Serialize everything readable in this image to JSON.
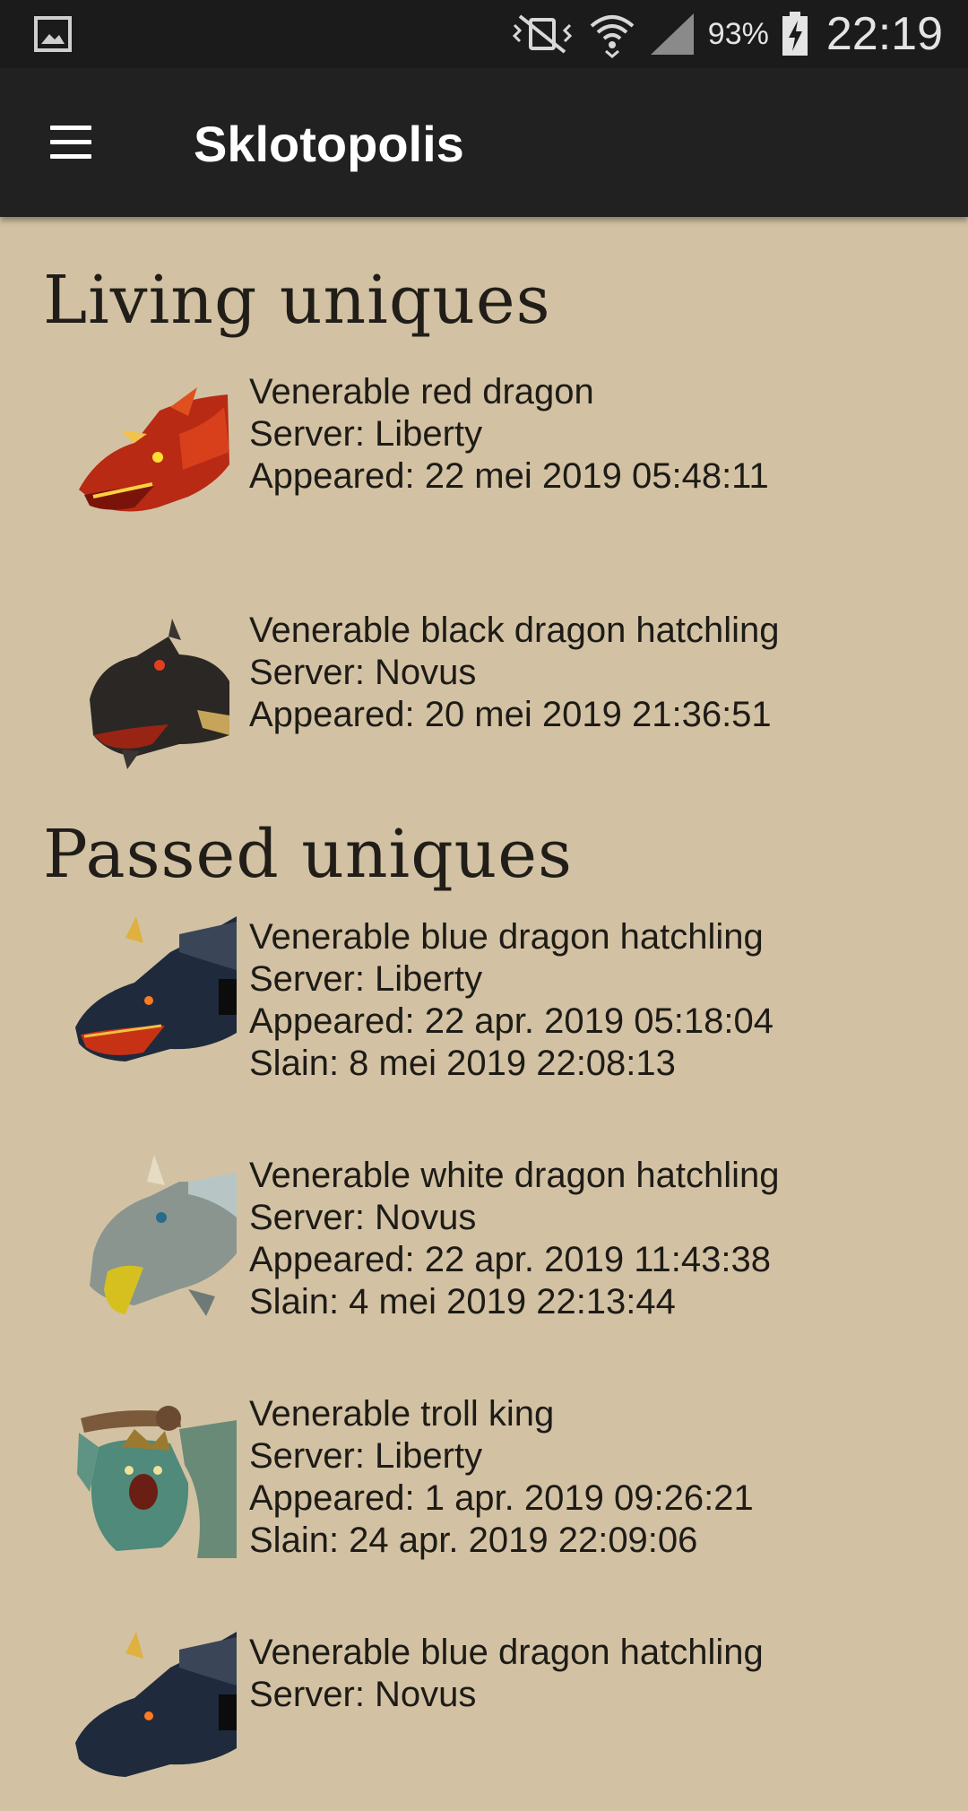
{
  "status_bar": {
    "battery_percent": "93%",
    "time": "22:19"
  },
  "app_bar": {
    "title": "Sklotopolis"
  },
  "living": {
    "heading": "Living uniques",
    "items": [
      {
        "name": "Venerable red dragon",
        "server": "Server: Liberty",
        "appeared": "Appeared: 22 mei 2019 05:48:11",
        "portrait_icon": "red-dragon-icon",
        "color": "#c0301a"
      },
      {
        "name": "Venerable black dragon hatchling",
        "server": "Server: Novus",
        "appeared": "Appeared: 20 mei 2019 21:36:51",
        "portrait_icon": "black-dragon-icon",
        "color": "#2a2725"
      }
    ]
  },
  "passed": {
    "heading": "Passed uniques",
    "items": [
      {
        "name": "Venerable blue dragon hatchling",
        "server": "Server: Liberty",
        "appeared": "Appeared: 22 apr. 2019 05:18:04",
        "slain": "Slain: 8 mei 2019 22:08:13",
        "portrait_icon": "blue-dragon-icon",
        "color": "#1f2a3d"
      },
      {
        "name": "Venerable white dragon hatchling",
        "server": "Server: Novus",
        "appeared": "Appeared: 22 apr. 2019 11:43:38",
        "slain": "Slain: 4 mei 2019 22:13:44",
        "portrait_icon": "white-dragon-icon",
        "color": "#8a9590"
      },
      {
        "name": "Venerable troll king",
        "server": "Server: Liberty",
        "appeared": "Appeared: 1 apr. 2019 09:26:21",
        "slain": "Slain: 24 apr. 2019 22:09:06",
        "portrait_icon": "troll-king-icon",
        "color": "#4f8a7a"
      },
      {
        "name": "Venerable blue dragon hatchling",
        "server": "Server: Novus",
        "portrait_icon": "blue-dragon-icon",
        "color": "#1f2a3d"
      }
    ]
  }
}
